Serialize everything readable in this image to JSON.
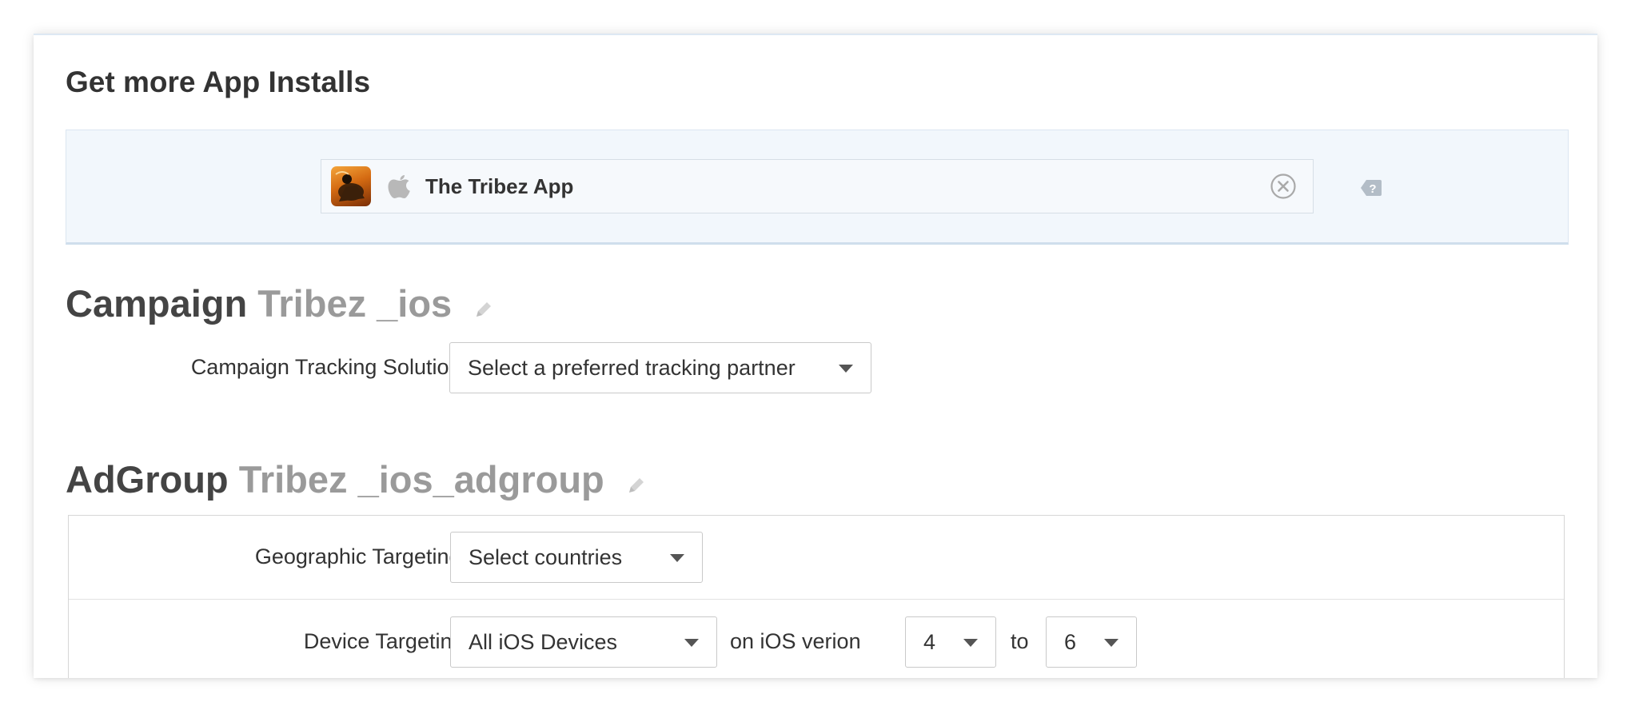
{
  "page": {
    "title": "Get more App Installs"
  },
  "app_selector": {
    "app_name": "The Tribez App",
    "platform_icon": "apple-icon",
    "clear_icon": "close-circle-icon",
    "help_icon": "help-icon"
  },
  "campaign": {
    "heading": "Campaign",
    "name": "Tribez _ios",
    "edit_icon": "pencil-icon",
    "tracking_label": "Campaign Tracking Solution:",
    "tracking_value": "Select a preferred tracking partner"
  },
  "adgroup": {
    "heading": "AdGroup",
    "name": "Tribez _ios_adgroup",
    "edit_icon": "pencil-icon",
    "geo_label": "Geographic Targeting:",
    "geo_value": "Select countries",
    "device_label": "Device Targeting:",
    "device_value": "All iOS Devices",
    "os_text": "on iOS verion",
    "os_from": "4",
    "to_text": "to",
    "os_to": "6"
  },
  "colors": {
    "panel_bg": "#f2f7fc",
    "title_text": "#333333",
    "muted_name": "#9a9a9a"
  }
}
